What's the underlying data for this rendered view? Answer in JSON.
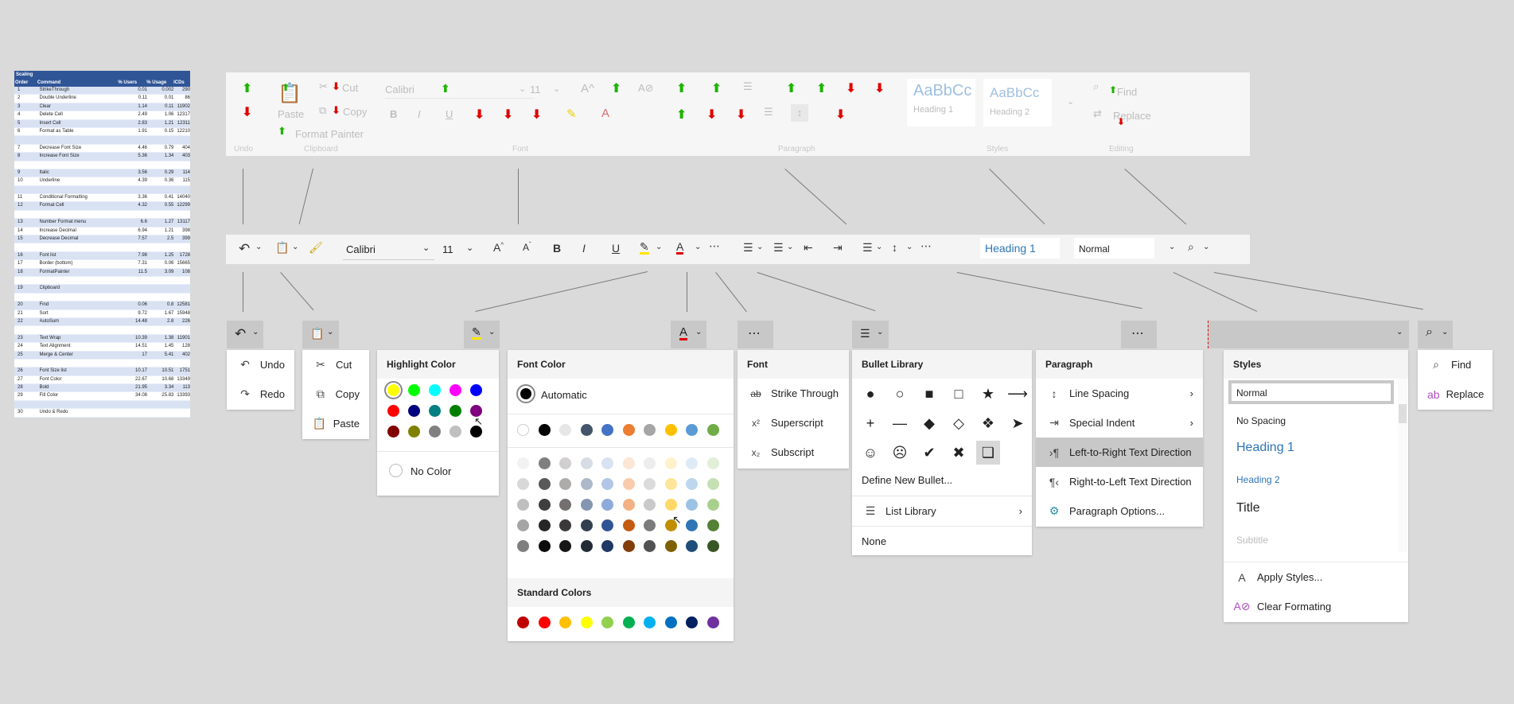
{
  "sheet": {
    "title": "Scaling",
    "columns": [
      "Order",
      "Command",
      "% Users",
      "% Usage",
      "ICDs"
    ],
    "rows": [
      [
        "1",
        "StrikeThrough",
        "0.01",
        "0.002",
        "290"
      ],
      [
        "2",
        "Double Underline",
        "0.11",
        "0.01",
        "86"
      ],
      [
        "3",
        "Clear",
        "1.14",
        "0.11",
        "11902"
      ],
      [
        "4",
        "Delete Cell",
        "2.49",
        "1.06",
        "12317"
      ],
      [
        "5",
        "Insert Cell",
        "2.83",
        "1.21",
        "12311"
      ],
      [
        "6",
        "Format as Table",
        "1.91",
        "0.15",
        "12210"
      ],
      [
        "",
        "",
        "",
        "",
        ""
      ],
      [
        "7",
        "Decrease Font Size",
        "4.46",
        "0.79",
        "404"
      ],
      [
        "8",
        "Increase Font Size",
        "5.36",
        "1.34",
        "403"
      ],
      [
        "",
        "",
        "",
        "",
        ""
      ],
      [
        "9",
        "Italic",
        "3.56",
        "0.29",
        "114"
      ],
      [
        "10",
        "Underline",
        "4.39",
        "0.36",
        "115"
      ],
      [
        "",
        "",
        "",
        "",
        ""
      ],
      [
        "11",
        "Conditional Formatting",
        "3.36",
        "0.41",
        "14040"
      ],
      [
        "12",
        "Format Cell",
        "4.32",
        "0.55",
        "12299"
      ],
      [
        "",
        "",
        "",
        "",
        ""
      ],
      [
        "13",
        "Number Format menu",
        "6.6",
        "1.27",
        "13117"
      ],
      [
        "14",
        "Increase Decimal",
        "6.94",
        "1.21",
        "398"
      ],
      [
        "15",
        "Decrease Decimal",
        "7.57",
        "2.5",
        "399"
      ],
      [
        "",
        "",
        "",
        "",
        ""
      ],
      [
        "16",
        "Font list",
        "7.98",
        "1.25",
        "1728"
      ],
      [
        "17",
        "Border (bottom)",
        "7.31",
        "0.06",
        "15665"
      ],
      [
        "18",
        "FormatPainter",
        "11.5",
        "3.09",
        "108"
      ],
      [
        "",
        "",
        "",
        "",
        ""
      ],
      [
        "19",
        "Clipboard",
        "",
        "",
        ""
      ],
      [
        "",
        "",
        "",
        "",
        ""
      ],
      [
        "20",
        "Find",
        "0.06",
        "0.8",
        "12581"
      ],
      [
        "21",
        "Sort",
        "9.72",
        "1.67",
        "15948"
      ],
      [
        "22",
        "AutoSum",
        "14.48",
        "2.8",
        "226"
      ],
      [
        "",
        "",
        "",
        "",
        ""
      ],
      [
        "23",
        "Text Wrap",
        "10.39",
        "1.38",
        "11901"
      ],
      [
        "24",
        "Text Alignment",
        "14.51",
        "1.45",
        "128"
      ],
      [
        "25",
        "Merge & Center",
        "17",
        "5.41",
        "402"
      ],
      [
        "",
        "",
        "",
        "",
        ""
      ],
      [
        "26",
        "Font Size list",
        "10.17",
        "10.51",
        "1751"
      ],
      [
        "27",
        "Font Color",
        "22.67",
        "10.68",
        "13349"
      ],
      [
        "28",
        "Bold",
        "21.95",
        "3.34",
        "113"
      ],
      [
        "29",
        "Fill Color",
        "34.08",
        "25.83",
        "13393"
      ],
      [
        "",
        "",
        "",
        "",
        ""
      ],
      [
        "30",
        "Undo & Redo",
        "",
        "",
        ""
      ]
    ]
  },
  "big_ribbon": {
    "cut": "Cut",
    "copy": "Copy",
    "format_painter": "Format Painter",
    "paste": "Paste",
    "font_name": "Calibri",
    "font_size": "11",
    "style1_preview": "AaBbCc",
    "style1_name": "Heading 1",
    "style2_preview": "AaBbCc",
    "style2_name": "Heading 2",
    "find": "Find",
    "replace": "Replace",
    "groups": {
      "undo": "Undo",
      "clipboard": "Clipboard",
      "font": "Font",
      "paragraph": "Paragraph",
      "styles": "Styles",
      "editing": "Editing"
    }
  },
  "simple_ribbon": {
    "font_name": "Calibri",
    "font_size": "11",
    "heading_style": "Heading 1",
    "normal_style": "Normal"
  },
  "undo_menu": {
    "items": [
      "Undo",
      "Redo"
    ]
  },
  "clipboard_menu": {
    "items": [
      "Cut",
      "Copy",
      "Paste"
    ]
  },
  "highlight_menu": {
    "title": "Highlight Color",
    "no_color": "No Color",
    "colors": [
      "#ffff00",
      "#00ff00",
      "#00ffff",
      "#ff00ff",
      "#0000ff",
      "#ff0000",
      "#000080",
      "#008080",
      "#008000",
      "#800080",
      "#800000",
      "#808000",
      "#808080",
      "#c0c0c0",
      "#000000"
    ]
  },
  "font_color_menu": {
    "title": "Font Color",
    "automatic": "Automatic",
    "standard_title": "Standard Colors",
    "theme_top": [
      "#ffffff",
      "#000000",
      "#e7e6e6",
      "#44546a",
      "#4472c4",
      "#ed7d31",
      "#a5a5a5",
      "#ffc000",
      "#5b9bd5",
      "#70ad47"
    ],
    "theme_shades": [
      [
        "#f2f2f2",
        "#7f7f7f",
        "#d0cece",
        "#d6dce4",
        "#d9e2f3",
        "#fbe5d5",
        "#ededed",
        "#fff2cc",
        "#deebf6",
        "#e2efd9"
      ],
      [
        "#d8d8d8",
        "#595959",
        "#aeabab",
        "#adb9ca",
        "#b4c6e7",
        "#f7cbac",
        "#dbdbdb",
        "#fee599",
        "#bdd7ee",
        "#c5e0b3"
      ],
      [
        "#bfbfbf",
        "#3f3f3f",
        "#757070",
        "#8496b0",
        "#8eaadb",
        "#f4b183",
        "#c9c9c9",
        "#ffd965",
        "#9cc3e5",
        "#a8d08d"
      ],
      [
        "#a5a5a5",
        "#262626",
        "#3a3838",
        "#323f4f",
        "#2f5496",
        "#c55a11",
        "#7b7b7b",
        "#bf8f00",
        "#2e75b5",
        "#538135"
      ],
      [
        "#7f7f7f",
        "#0c0c0c",
        "#171616",
        "#222a35",
        "#1f3864",
        "#833c0b",
        "#525252",
        "#7f6000",
        "#1e4e79",
        "#375623"
      ]
    ],
    "standard": [
      "#c00000",
      "#ff0000",
      "#ffc000",
      "#ffff00",
      "#92d050",
      "#00b050",
      "#00b0f0",
      "#0070c0",
      "#002060",
      "#7030a0"
    ]
  },
  "font_menu": {
    "title": "Font",
    "items": [
      "Strike Through",
      "Superscript",
      "Subscript"
    ]
  },
  "bullet_menu": {
    "title": "Bullet Library",
    "symbols": [
      "●",
      "○",
      "■",
      "□",
      "★",
      "⟶",
      "+",
      "—",
      "◆",
      "◇",
      "❖",
      "➤",
      "☺",
      "☹",
      "✔",
      "✖",
      "❏"
    ],
    "define_new": "Define New Bullet...",
    "list_library": "List Library",
    "none": "None"
  },
  "paragraph_menu": {
    "title": "Paragraph",
    "items": [
      "Line Spacing",
      "Special Indent",
      "Left-to-Right Text Direction",
      "Right-to-Left Text Direction",
      "Paragraph Options..."
    ]
  },
  "styles_menu": {
    "title": "Styles",
    "items": [
      "Normal",
      "No Spacing",
      "Heading 1",
      "Heading 2",
      "Title",
      "Subtitle"
    ],
    "apply": "Apply Styles...",
    "clear": "Clear Formating"
  },
  "find_menu": {
    "items": [
      "Find",
      "Replace"
    ]
  },
  "colors": {
    "arrow_up": "#1db400",
    "arrow_down": "#e00000",
    "heading_blue": "#2e74b5",
    "sheet_header": "#2f5597",
    "sheet_alt": "#d9e2f3"
  }
}
